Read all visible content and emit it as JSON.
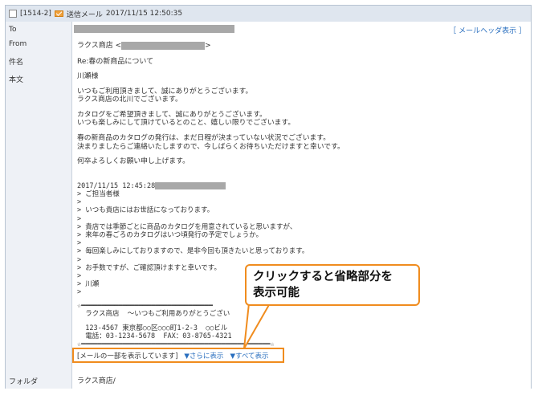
{
  "titlebar": {
    "id": "[1514-2]",
    "mail_type": "送信メール",
    "datetime": "2017/11/15 12:50:35"
  },
  "fields": {
    "to": {
      "label": "To",
      "header_link": "［ メールヘッダ表示 ］"
    },
    "from": {
      "label": "From",
      "name": "ラクス商店 <",
      "close": ">"
    },
    "subject": {
      "label": "件名",
      "value": "Re:春の新商品について"
    },
    "body": {
      "label": "本文"
    },
    "folder": {
      "label": "フォルダ",
      "value": "ラクス商店/"
    }
  },
  "body_text": {
    "greeting": "川瀬様",
    "p1": "いつもご利用頂きまして、誠にありがとうございます。\nラクス商店の北川でございます。",
    "p2": "カタログをご希望頂きまして、誠にありがとうございます。\nいつも楽しみにして頂けているとのこと、嬉しい限りでございます。",
    "p3": "春の新商品のカタログの発行は、まだ日程が決まっていない状況でございます。\n決まりましたらご連絡いたしますので、今しばらくお待ちいただけますと幸いです。",
    "p4": "何卒よろしくお願い申し上げます。",
    "quote_date": "2017/11/15 12:45:28",
    "quote": "> ご担当者様\n>\n> いつも貴店にはお世話になっております。\n>\n> 貴店では季節ごとに商品のカタログを用意されていると思いますが、\n> 来年の春ごろのカタログはいつ頃発行の予定でしょうか。\n>\n> 毎回楽しみにしておりますので、是非今回も頂きたいと思っております。\n>\n> お手数ですが、ご確認頂けますと幸いです。\n>\n> 川瀬\n>",
    "signature_top": "☆━━━━━━━━━━━━━━━━━━━━━━━━━━━━━━━━",
    "signature_name": "  ラクス商店  ～いつもご利用ありがとうござい",
    "signature_addr": "  123-4567 東京都○○区○○○町1-2-3  ○○ビル",
    "signature_tel": "  電話：03-1234-5678  FAX：03-8765-4321",
    "signature_bottom": "☆━━━━━━━━━━━━━━━━━━━━━━━━━━━━━━━━━━━━━━━━━━━━━━☆"
  },
  "partial": {
    "notice": "[メールの一部を表示しています]",
    "more": "▼さらに表示",
    "all": "▼すべて表示"
  },
  "callout": {
    "line1": "クリックすると省略部分を",
    "line2": "表示可能"
  },
  "colors": {
    "accent": "#f08c1e",
    "link": "#2a6fbf"
  }
}
